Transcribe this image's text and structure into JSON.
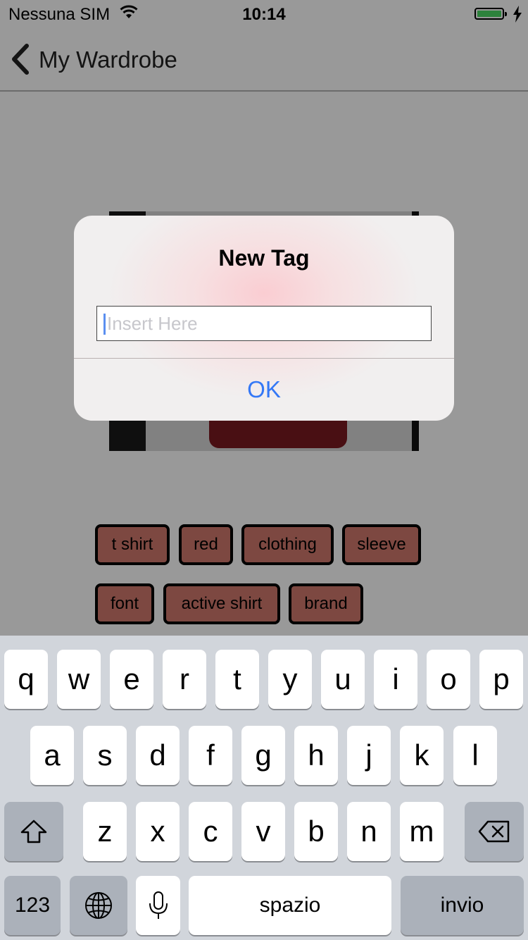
{
  "status_bar": {
    "carrier": "Nessuna SIM",
    "time": "10:14",
    "battery_color": "#4cd964"
  },
  "nav": {
    "back_label": "My Wardrobe"
  },
  "tags": [
    "t shirt",
    "red",
    "clothing",
    "sleeve",
    "font",
    "active shirt",
    "brand"
  ],
  "alert": {
    "title": "New Tag",
    "input_value": "",
    "input_placeholder": "Insert Here",
    "ok_label": "OK",
    "ok_color": "#3478f6"
  },
  "keyboard": {
    "row1": [
      "q",
      "w",
      "e",
      "r",
      "t",
      "y",
      "u",
      "i",
      "o",
      "p"
    ],
    "row2": [
      "a",
      "s",
      "d",
      "f",
      "g",
      "h",
      "j",
      "k",
      "l"
    ],
    "row3": [
      "z",
      "x",
      "c",
      "v",
      "b",
      "n",
      "m"
    ],
    "numbers_label": "123",
    "space_label": "spazio",
    "return_label": "invio"
  }
}
